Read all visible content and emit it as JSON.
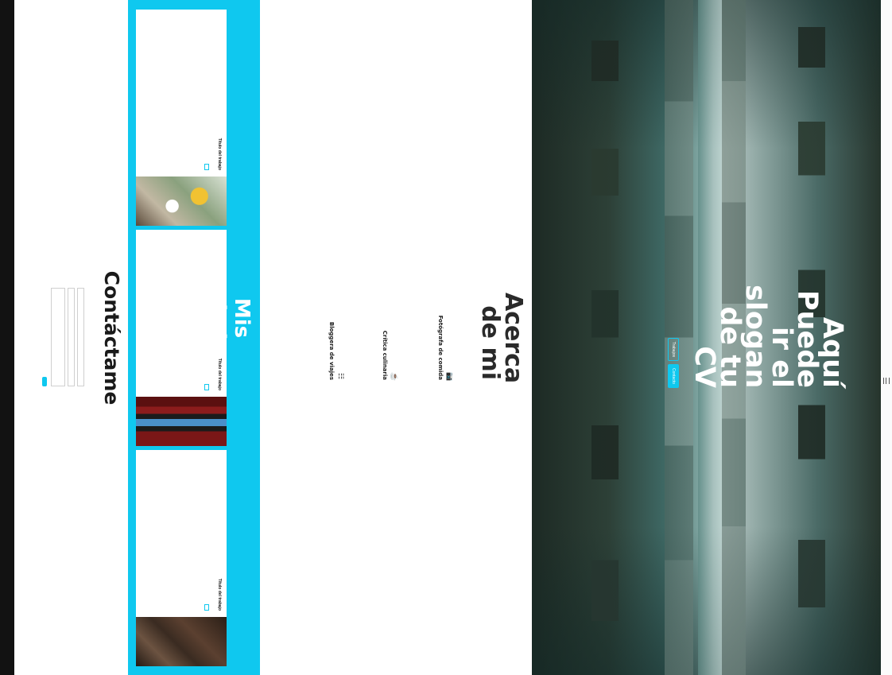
{
  "brand": "",
  "hero": {
    "title": "Aquí Puede ir el slogan de tu CV",
    "subtitle": "",
    "works_button": "Trabajos",
    "contact_button": "Contacto"
  },
  "about": {
    "title": "Acerca de mi",
    "intro": "",
    "services": [
      {
        "icon": "camera-icon",
        "title": "Fotógrafa de comida",
        "text": ""
      },
      {
        "icon": "chef-icon",
        "title": "Crítica culinaria",
        "text": ""
      },
      {
        "icon": "map-icon",
        "title": "Bloggera de viajes",
        "text": ""
      }
    ]
  },
  "works": {
    "title": "Mis trabajos",
    "cards": [
      {
        "title": "Título del trabajo",
        "text": "",
        "link": ""
      },
      {
        "title": "Título del trabajo",
        "text": "",
        "link": ""
      },
      {
        "title": "Título del trabajo",
        "text": "",
        "link": ""
      }
    ]
  },
  "contact": {
    "title": "Contáctame",
    "name_label": "",
    "name_placeholder": "",
    "email_label": "",
    "email_placeholder": "",
    "message_label": "",
    "message_placeholder": "",
    "submit_label": ""
  },
  "footer": {
    "text": ""
  },
  "colors": {
    "accent": "#0fc8ef",
    "footer_bg": "#121212",
    "text_dark": "#1a1a1a"
  }
}
